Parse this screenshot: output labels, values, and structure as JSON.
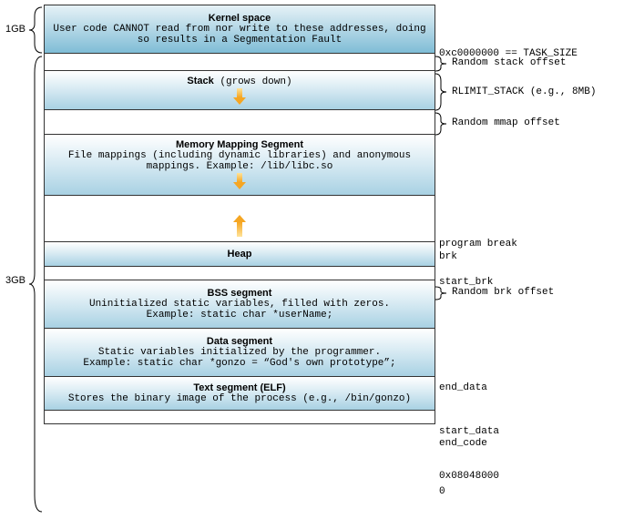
{
  "left": {
    "top_label": "1GB",
    "bottom_label": "3GB"
  },
  "segments": {
    "kernel": {
      "title": "Kernel space",
      "desc": "User code CANNOT read from nor write to these addresses, doing so results in a Segmentation Fault"
    },
    "stack": {
      "title": "Stack",
      "suffix": " (grows down)"
    },
    "mmap": {
      "title": "Memory Mapping Segment",
      "desc": "File mappings (including dynamic libraries) and anonymous mappings. Example: /lib/libc.so"
    },
    "heap": {
      "title": "Heap"
    },
    "bss": {
      "title": "BSS segment",
      "desc1": "Uninitialized static variables, filled with zeros.",
      "desc2": "Example: static char *userName;"
    },
    "data": {
      "title": "Data segment",
      "desc1": "Static variables initialized by the programmer.",
      "desc2": "Example: static char *gonzo = “God's own prototype”;"
    },
    "text": {
      "title": "Text segment (ELF)",
      "desc": "Stores the binary image of the process (e.g., /bin/gonzo)"
    }
  },
  "right": {
    "task_size": "0xc0000000 == TASK_SIZE",
    "rand_stack": "Random stack offset",
    "rlimit": "RLIMIT_STACK (e.g., 8MB)",
    "rand_mmap": "Random mmap offset",
    "program_break": "program break",
    "brk": "brk",
    "start_brk": "start_brk",
    "rand_brk": "Random brk offset",
    "end_data": "end_data",
    "start_data": "start_data",
    "end_code": "end_code",
    "text_addr": "0x08048000",
    "zero": "0"
  }
}
